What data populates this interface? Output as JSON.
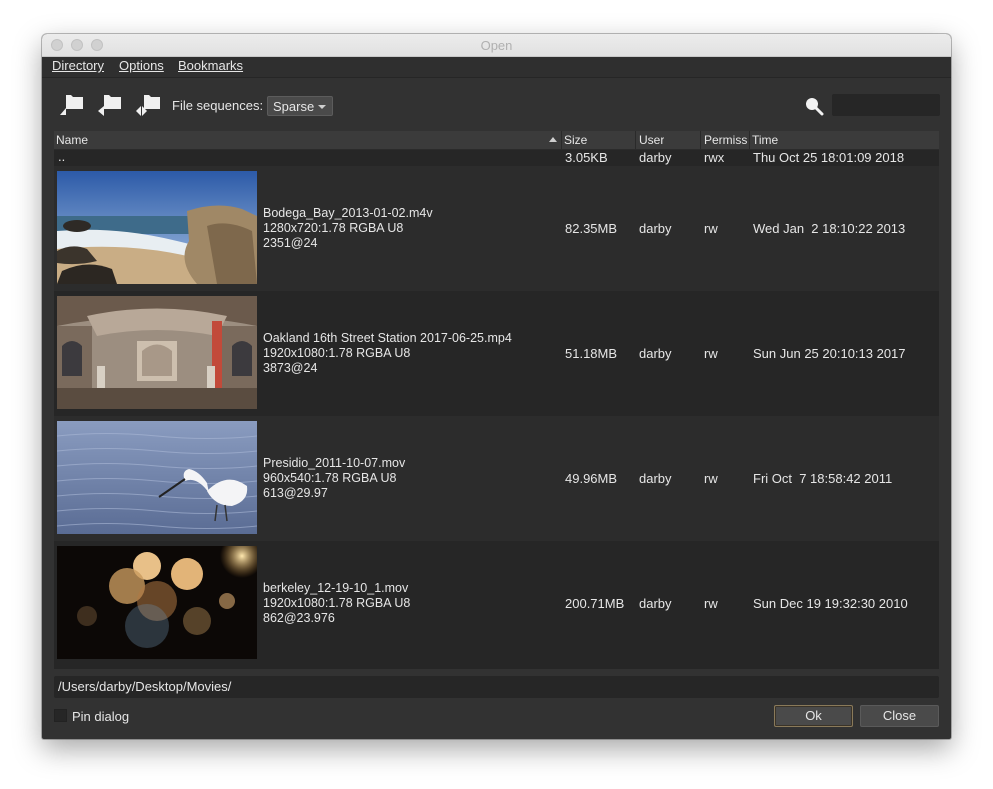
{
  "window": {
    "title": "Open"
  },
  "menubar": {
    "items": [
      "Directory",
      "Options",
      "Bookmarks"
    ]
  },
  "toolbar": {
    "file_sequences_label": "File sequences:",
    "file_sequences_value": "Sparse",
    "search_value": ""
  },
  "columns": {
    "name": "Name",
    "size": "Size",
    "user": "User",
    "permissions": "Permiss",
    "time": "Time"
  },
  "parent_row": {
    "name": "..",
    "size": "3.05KB",
    "user": "darby",
    "perms": "rwx",
    "time": "Thu Oct 25 18:01:09 2018"
  },
  "files": [
    {
      "name": "Bodega_Bay_2013-01-02.m4v",
      "resolution": "1280x720:1.78 RGBA U8",
      "frames": "2351@24",
      "size": "82.35MB",
      "user": "darby",
      "perms": "rw",
      "time": "Wed Jan  2 18:10:22 2013",
      "thumb": "beach"
    },
    {
      "name": "Oakland 16th Street Station 2017-06-25.mp4",
      "resolution": "1920x1080:1.78 RGBA U8",
      "frames": "3873@24",
      "size": "51.18MB",
      "user": "darby",
      "perms": "rw",
      "time": "Sun Jun 25 20:10:13 2017",
      "thumb": "station"
    },
    {
      "name": "Presidio_2011-10-07.mov",
      "resolution": "960x540:1.78 RGBA U8",
      "frames": "613@29.97",
      "size": "49.96MB",
      "user": "darby",
      "perms": "rw",
      "time": "Fri Oct  7 18:58:42 2011",
      "thumb": "egret"
    },
    {
      "name": "berkeley_12-19-10_1.mov",
      "resolution": "1920x1080:1.78 RGBA U8",
      "frames": "862@23.976",
      "size": "200.71MB",
      "user": "darby",
      "perms": "rw",
      "time": "Sun Dec 19 19:32:30 2010",
      "thumb": "lanterns"
    }
  ],
  "path": "/Users/darby/Desktop/Movies/",
  "footer": {
    "pin_label": "Pin dialog",
    "ok_label": "Ok",
    "close_label": "Close"
  }
}
